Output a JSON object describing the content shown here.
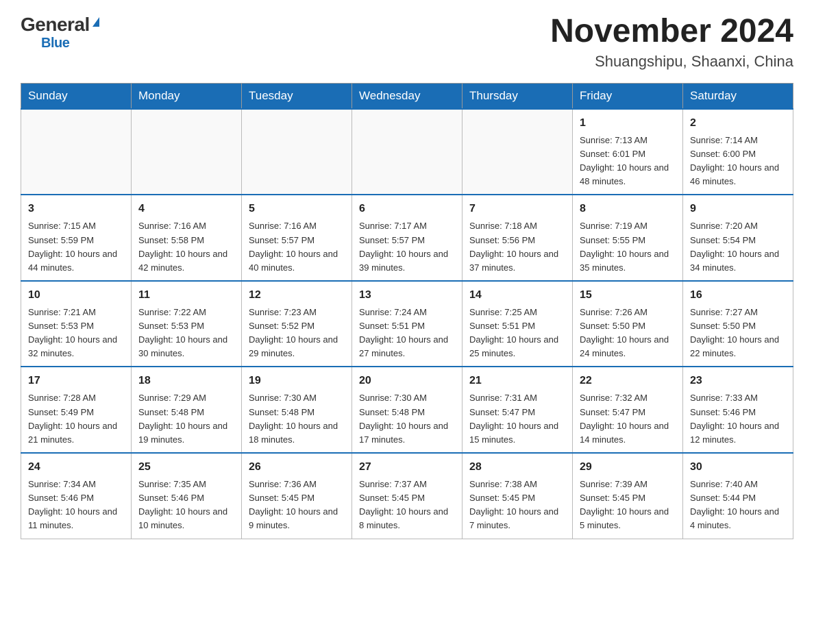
{
  "header": {
    "logo": {
      "general": "General",
      "blue": "Blue"
    },
    "title": "November 2024",
    "location": "Shuangshipu, Shaanxi, China"
  },
  "days_of_week": [
    "Sunday",
    "Monday",
    "Tuesday",
    "Wednesday",
    "Thursday",
    "Friday",
    "Saturday"
  ],
  "weeks": [
    [
      {
        "day": "",
        "info": ""
      },
      {
        "day": "",
        "info": ""
      },
      {
        "day": "",
        "info": ""
      },
      {
        "day": "",
        "info": ""
      },
      {
        "day": "",
        "info": ""
      },
      {
        "day": "1",
        "info": "Sunrise: 7:13 AM\nSunset: 6:01 PM\nDaylight: 10 hours and 48 minutes."
      },
      {
        "day": "2",
        "info": "Sunrise: 7:14 AM\nSunset: 6:00 PM\nDaylight: 10 hours and 46 minutes."
      }
    ],
    [
      {
        "day": "3",
        "info": "Sunrise: 7:15 AM\nSunset: 5:59 PM\nDaylight: 10 hours and 44 minutes."
      },
      {
        "day": "4",
        "info": "Sunrise: 7:16 AM\nSunset: 5:58 PM\nDaylight: 10 hours and 42 minutes."
      },
      {
        "day": "5",
        "info": "Sunrise: 7:16 AM\nSunset: 5:57 PM\nDaylight: 10 hours and 40 minutes."
      },
      {
        "day": "6",
        "info": "Sunrise: 7:17 AM\nSunset: 5:57 PM\nDaylight: 10 hours and 39 minutes."
      },
      {
        "day": "7",
        "info": "Sunrise: 7:18 AM\nSunset: 5:56 PM\nDaylight: 10 hours and 37 minutes."
      },
      {
        "day": "8",
        "info": "Sunrise: 7:19 AM\nSunset: 5:55 PM\nDaylight: 10 hours and 35 minutes."
      },
      {
        "day": "9",
        "info": "Sunrise: 7:20 AM\nSunset: 5:54 PM\nDaylight: 10 hours and 34 minutes."
      }
    ],
    [
      {
        "day": "10",
        "info": "Sunrise: 7:21 AM\nSunset: 5:53 PM\nDaylight: 10 hours and 32 minutes."
      },
      {
        "day": "11",
        "info": "Sunrise: 7:22 AM\nSunset: 5:53 PM\nDaylight: 10 hours and 30 minutes."
      },
      {
        "day": "12",
        "info": "Sunrise: 7:23 AM\nSunset: 5:52 PM\nDaylight: 10 hours and 29 minutes."
      },
      {
        "day": "13",
        "info": "Sunrise: 7:24 AM\nSunset: 5:51 PM\nDaylight: 10 hours and 27 minutes."
      },
      {
        "day": "14",
        "info": "Sunrise: 7:25 AM\nSunset: 5:51 PM\nDaylight: 10 hours and 25 minutes."
      },
      {
        "day": "15",
        "info": "Sunrise: 7:26 AM\nSunset: 5:50 PM\nDaylight: 10 hours and 24 minutes."
      },
      {
        "day": "16",
        "info": "Sunrise: 7:27 AM\nSunset: 5:50 PM\nDaylight: 10 hours and 22 minutes."
      }
    ],
    [
      {
        "day": "17",
        "info": "Sunrise: 7:28 AM\nSunset: 5:49 PM\nDaylight: 10 hours and 21 minutes."
      },
      {
        "day": "18",
        "info": "Sunrise: 7:29 AM\nSunset: 5:48 PM\nDaylight: 10 hours and 19 minutes."
      },
      {
        "day": "19",
        "info": "Sunrise: 7:30 AM\nSunset: 5:48 PM\nDaylight: 10 hours and 18 minutes."
      },
      {
        "day": "20",
        "info": "Sunrise: 7:30 AM\nSunset: 5:48 PM\nDaylight: 10 hours and 17 minutes."
      },
      {
        "day": "21",
        "info": "Sunrise: 7:31 AM\nSunset: 5:47 PM\nDaylight: 10 hours and 15 minutes."
      },
      {
        "day": "22",
        "info": "Sunrise: 7:32 AM\nSunset: 5:47 PM\nDaylight: 10 hours and 14 minutes."
      },
      {
        "day": "23",
        "info": "Sunrise: 7:33 AM\nSunset: 5:46 PM\nDaylight: 10 hours and 12 minutes."
      }
    ],
    [
      {
        "day": "24",
        "info": "Sunrise: 7:34 AM\nSunset: 5:46 PM\nDaylight: 10 hours and 11 minutes."
      },
      {
        "day": "25",
        "info": "Sunrise: 7:35 AM\nSunset: 5:46 PM\nDaylight: 10 hours and 10 minutes."
      },
      {
        "day": "26",
        "info": "Sunrise: 7:36 AM\nSunset: 5:45 PM\nDaylight: 10 hours and 9 minutes."
      },
      {
        "day": "27",
        "info": "Sunrise: 7:37 AM\nSunset: 5:45 PM\nDaylight: 10 hours and 8 minutes."
      },
      {
        "day": "28",
        "info": "Sunrise: 7:38 AM\nSunset: 5:45 PM\nDaylight: 10 hours and 7 minutes."
      },
      {
        "day": "29",
        "info": "Sunrise: 7:39 AM\nSunset: 5:45 PM\nDaylight: 10 hours and 5 minutes."
      },
      {
        "day": "30",
        "info": "Sunrise: 7:40 AM\nSunset: 5:44 PM\nDaylight: 10 hours and 4 minutes."
      }
    ]
  ]
}
